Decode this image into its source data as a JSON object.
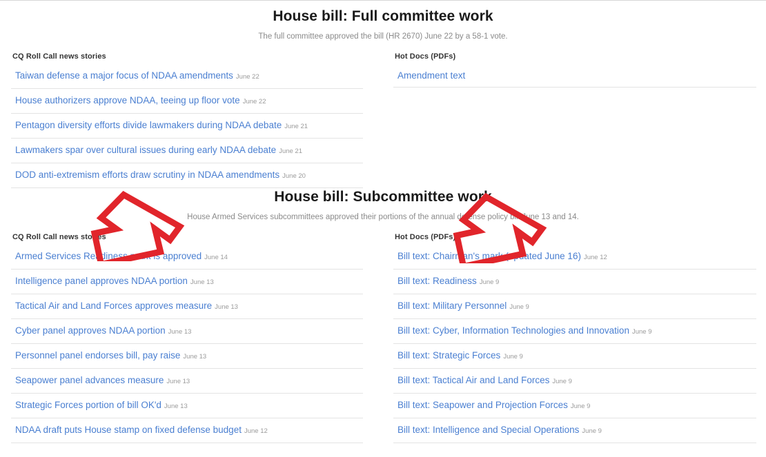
{
  "annotations": {
    "arrow_color": "#E1252B",
    "arrows": [
      {
        "name": "arrow-pointing-to-left-column",
        "direction": "down-left"
      },
      {
        "name": "arrow-pointing-to-right-column",
        "direction": "down-left"
      }
    ]
  },
  "sections": [
    {
      "id": "full-committee",
      "title": "House bill: Full committee work",
      "subtitle": "The full committee approved the bill (HR 2670) June 22 by a 58-1 vote.",
      "left": {
        "heading": "CQ Roll Call news stories",
        "items": [
          {
            "title": "Taiwan defense a major focus of NDAA amendments",
            "date": "June 22"
          },
          {
            "title": "House authorizers approve NDAA, teeing up floor vote",
            "date": "June 22"
          },
          {
            "title": "Pentagon diversity efforts divide lawmakers during NDAA debate",
            "date": "June 21"
          },
          {
            "title": "Lawmakers spar over cultural issues during early NDAA debate",
            "date": "June 21"
          },
          {
            "title": "DOD anti-extremism efforts draw scrutiny in NDAA amendments",
            "date": "June 20"
          }
        ]
      },
      "right": {
        "heading": "Hot Docs (PDFs)",
        "items": [
          {
            "title": "Amendment text",
            "date": ""
          }
        ]
      }
    },
    {
      "id": "subcommittee",
      "title": "House bill: Subcommittee work",
      "subtitle": "House Armed Services subcommittees approved their portions of the annual defense policy bill June 13 and 14.",
      "left": {
        "heading": "CQ Roll Call news stories",
        "items": [
          {
            "title": "Armed Services Readiness mark is approved",
            "date": "June 14"
          },
          {
            "title": "Intelligence panel approves NDAA portion",
            "date": "June 13"
          },
          {
            "title": "Tactical Air and Land Forces approves measure",
            "date": "June 13"
          },
          {
            "title": "Cyber panel approves NDAA portion",
            "date": "June 13"
          },
          {
            "title": "Personnel panel endorses bill, pay raise",
            "date": "June 13"
          },
          {
            "title": "Seapower panel advances measure",
            "date": "June 13"
          },
          {
            "title": "Strategic Forces portion of bill OK'd",
            "date": "June 13"
          },
          {
            "title": "NDAA draft puts House stamp on fixed defense budget",
            "date": "June 12"
          }
        ]
      },
      "right": {
        "heading": "Hot Docs (PDFs)",
        "items": [
          {
            "title": "Bill text: Chairman's mark (updated June 16)",
            "date": "June 12"
          },
          {
            "title": "Bill text: Readiness",
            "date": "June 9"
          },
          {
            "title": "Bill text: Military Personnel",
            "date": "June 9"
          },
          {
            "title": "Bill text: Cyber, Information Technologies and Innovation",
            "date": "June 9"
          },
          {
            "title": "Bill text: Strategic Forces",
            "date": "June 9"
          },
          {
            "title": "Bill text: Tactical Air and Land Forces",
            "date": "June 9"
          },
          {
            "title": "Bill text: Seapower and Projection Forces",
            "date": "June 9"
          },
          {
            "title": "Bill text: Intelligence and Special Operations",
            "date": "June 9"
          }
        ]
      }
    }
  ],
  "colors": {
    "link": "#4a7fd1",
    "date": "#9b9b9b",
    "heading": "#333333",
    "subtitle": "#8a8a8a",
    "rule": "#e3e3e3"
  }
}
